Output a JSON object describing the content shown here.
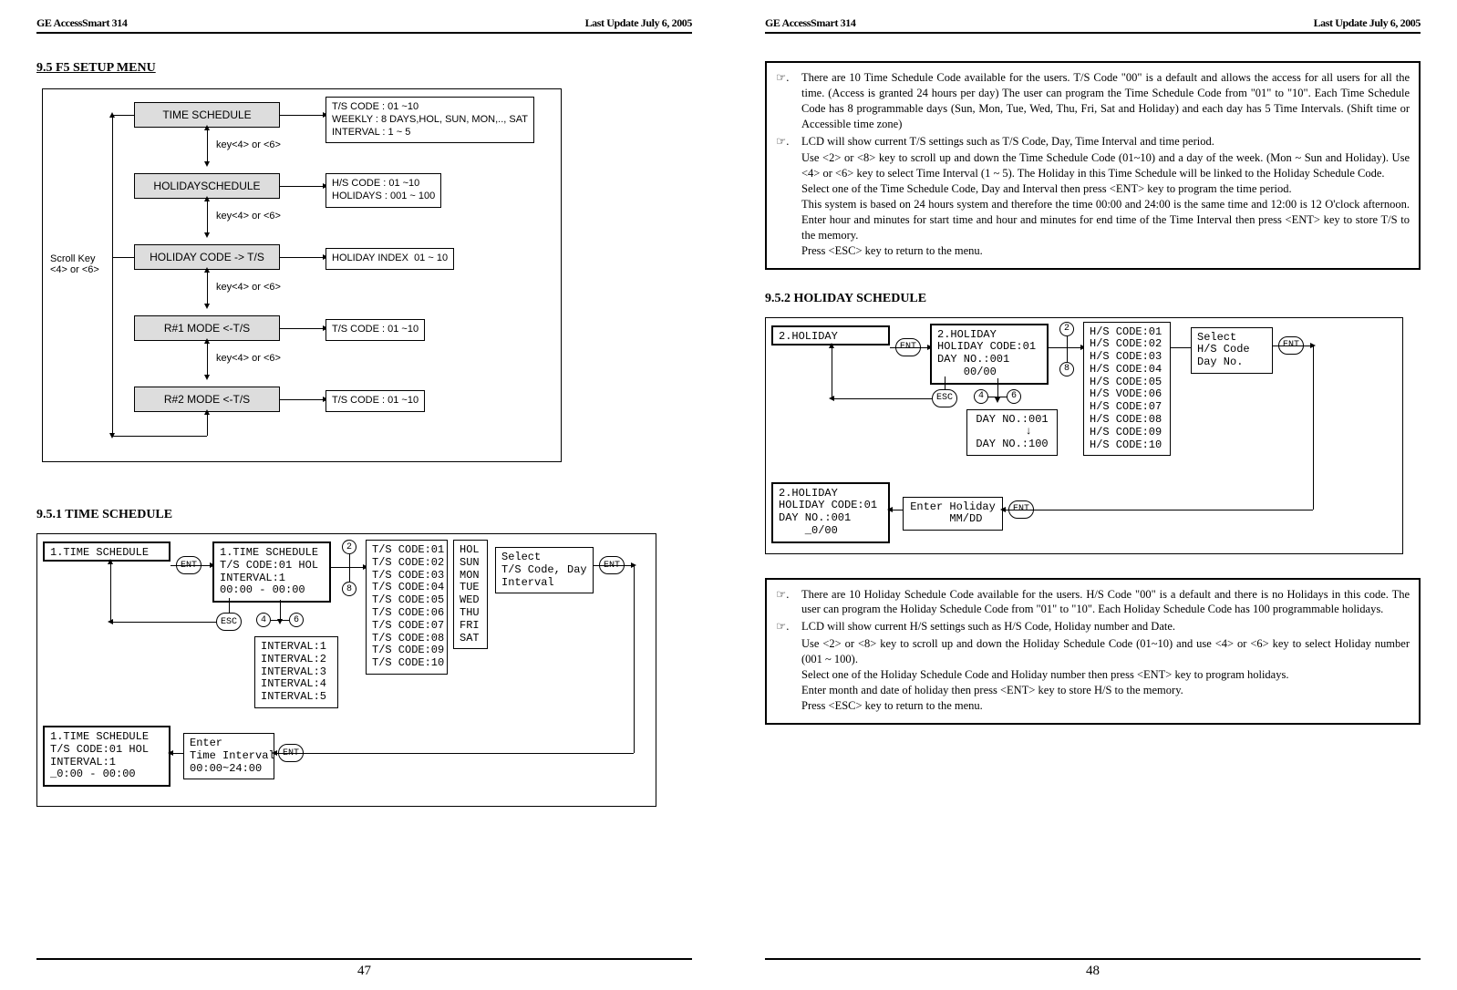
{
  "header": {
    "product": "GE AccessSmart 314",
    "update": "Last Update July 6, 2005"
  },
  "pages": {
    "left": "47",
    "right": "48"
  },
  "section95": {
    "title": "9.5 F5 SETUP MENU",
    "diagram": {
      "scroll_label": "Scroll Key\n<4> or <6>",
      "key_label": "key<4> or <6>",
      "items": {
        "time_schedule": "TIME SCHEDULE",
        "ts_right": "T/S CODE : 01 ~10\nWEEKLY : 8 DAYS,HOL, SUN, MON,.., SAT\nINTERVAL : 1 ~ 5",
        "holiday_schedule": "HOLIDAYSCHEDULE",
        "hs_right": "H/S CODE : 01 ~10\nHOLIDAYS : 001 ~ 100",
        "holiday_code_ts": "HOLIDAY CODE -> T/S",
        "hi_right": "HOLIDAY INDEX  01 ~ 10",
        "r1_mode": "R#1 MODE <-T/S",
        "r1_right": "T/S CODE : 01 ~10",
        "r2_mode": "R#2 MODE <-T/S",
        "r2_right": "T/S CODE : 01 ~10"
      }
    }
  },
  "section951": {
    "title": "9.5.1 TIME SCHEDULE",
    "screens": {
      "a": "1.TIME SCHEDULE",
      "b": "1.TIME SCHEDULE\nT/S CODE:01 HOL\nINTERVAL:1\n00:00 - 00:00",
      "ts_list": "T/S CODE:01\nT/S CODE:02\nT/S CODE:03\nT/S CODE:04\nT/S CODE:05\nT/S CODE:06\nT/S CODE:07\nT/S CODE:08\nT/S CODE:09\nT/S CODE:10",
      "days": "HOL\nSUN\nMON\nTUE\nWED\nTHU\nFRI\nSAT",
      "select": "Select\nT/S Code, Day\nInterval",
      "interval_list": "INTERVAL:1\nINTERVAL:2\nINTERVAL:3\nINTERVAL:4\nINTERVAL:5",
      "enter_interval": "Enter\nTime Interval\n00:00~24:00",
      "edit": "1.TIME SCHEDULE\nT/S CODE:01 HOL\nINTERVAL:1\n_0:00 - 00:00"
    },
    "badges": {
      "ent": "ENT",
      "esc": "ESC",
      "k2": "2",
      "k4": "4",
      "k6": "6",
      "k8": "8"
    }
  },
  "right_notes_ts": {
    "l1": "There are 10 Time Schedule Code available for the users. T/S Code \"00\" is a default and allows the access for all users for all the time. (Access is granted 24 hours per day) The user can program the Time Schedule Code from \"01\" to \"10\". Each Time Schedule Code has 8 programmable days (Sun, Mon, Tue, Wed, Thu, Fri, Sat and Holiday) and each day has 5 Time Intervals. (Shift time or Accessible time zone)",
    "l2": "LCD will show current T/S settings such as T/S Code, Day, Time Interval and time period.",
    "l3": "Use <2> or <8> key to scroll up and down the Time Schedule Code (01~10) and a day of the week. (Mon ~ Sun and Holiday). Use <4> or <6> key to select Time Interval (1 ~ 5). The Holiday in this Time Schedule will be linked to the Holiday Schedule Code.",
    "l4": "Select one of the Time Schedule Code, Day and Interval then press <ENT> key to program the time period.",
    "l5": "This system is based on 24 hours system and therefore the time 00:00 and 24:00 is the same time and 12:00 is 12 O'clock afternoon. Enter hour and minutes for start time and hour and minutes for end time of the Time Interval then press <ENT> key to store T/S to the memory.",
    "l6": "Press <ESC> key to return to the menu."
  },
  "section952": {
    "title": "9.5.2 HOLIDAY SCHEDULE",
    "screens": {
      "a": "2.HOLIDAY",
      "b": "2.HOLIDAY\nHOLIDAY CODE:01\nDAY NO.:001\n    00/00",
      "hs_list": "H/S CODE:01\nH/S CODE:02\nH/S CODE:03\nH/S CODE:04\nH/S CODE:05\nH/S VODE:06\nH/S CODE:07\nH/S CODE:08\nH/S CODE:09\nH/S CODE:10",
      "select": "Select\nH/S Code\nDay No.",
      "dayno": "DAY NO.:001\n     ↓\nDAY NO.:100",
      "edit": "2.HOLIDAY\nHOLIDAY CODE:01\nDAY NO.:001\n    _0/00",
      "enter": "Enter Holiday\n    MM/DD"
    }
  },
  "right_notes_hs": {
    "l1": "There are 10 Holiday Schedule Code available for the users. H/S Code \"00\" is a default and there is no Holidays in this code. The user can program the Holiday Schedule Code from \"01\" to \"10\". Each Holiday Schedule Code has 100 programmable holidays.",
    "l2": "LCD will show current H/S settings such as H/S Code, Holiday number and Date.",
    "l3": "Use <2> or <8> key to scroll up and down the Holiday Schedule Code (01~10) and use <4> or <6> key to select Holiday number (001 ~ 100).",
    "l4": "Select one of the Holiday Schedule Code and Holiday number then press <ENT> key to program holidays.",
    "l5": "Enter month and date of holiday then press <ENT> key to store H/S to the memory.",
    "l6": "Press <ESC> key to return to the menu."
  },
  "sym": {
    "tip": "☞."
  }
}
